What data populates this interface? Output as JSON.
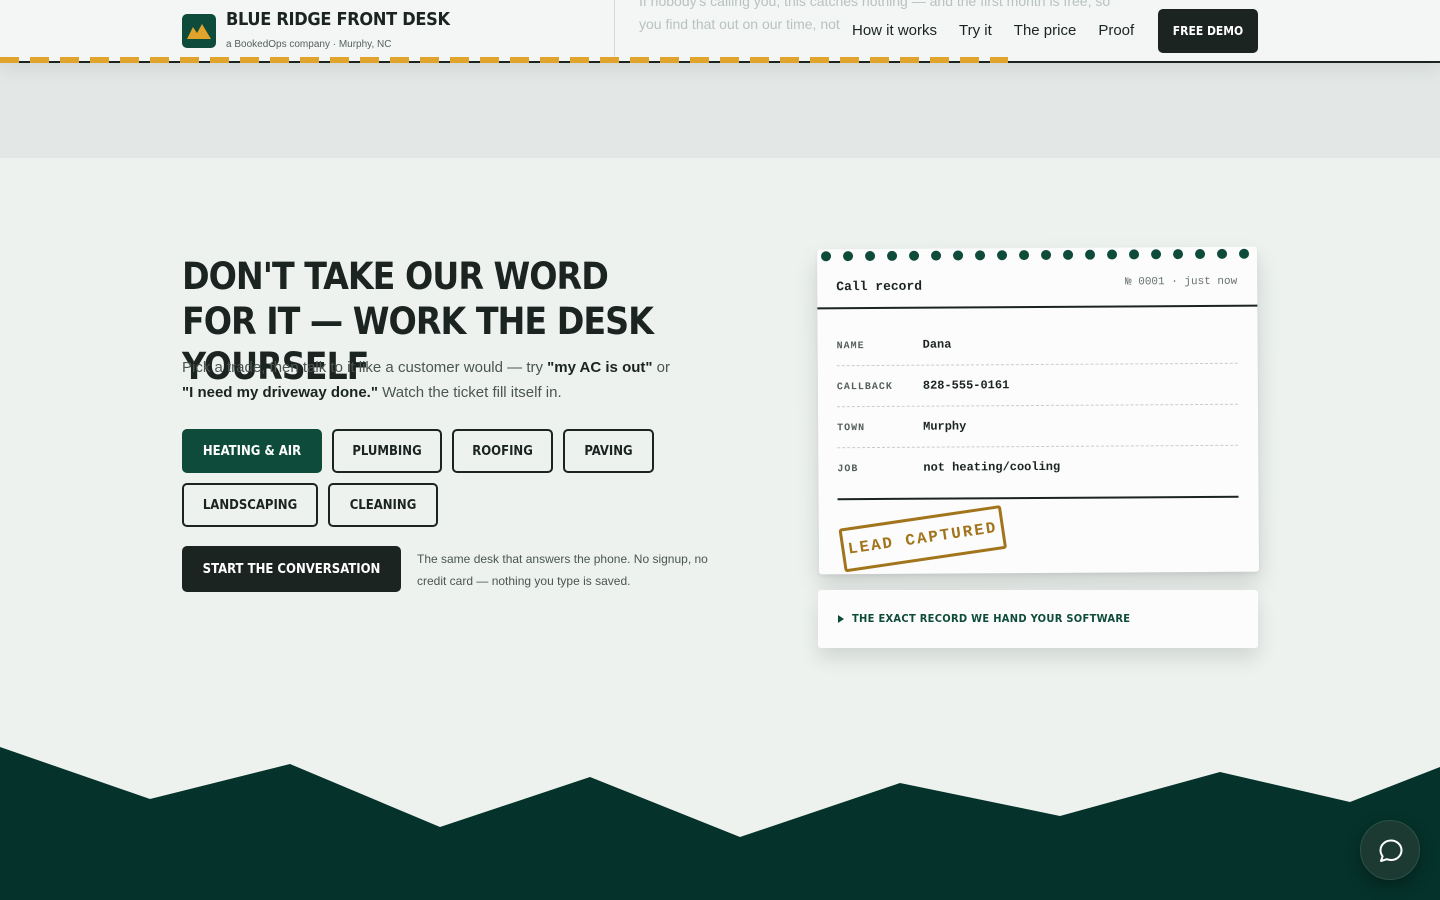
{
  "header": {
    "brand_name": "BLUE RIDGE FRONT DESK",
    "brand_sub": "a BookedOps company · Murphy, NC",
    "background_text": "If nobody's calling you, this catches nothing — and the first month is free, so you find that out on our time, not",
    "nav": [
      "How it works",
      "Try it",
      "The price",
      "Proof"
    ],
    "cta_label": "FREE DEMO"
  },
  "demo": {
    "headline": "DON'T TAKE OUR WORD FOR IT — WORK THE DESK YOURSELF",
    "intro": {
      "part1": "Pick a trade, then talk to it like a customer would — try ",
      "example1": "\"my AC is out\"",
      "part2": " or ",
      "example2": "\"I need my driveway done.\"",
      "part3": " Watch the ticket fill itself in."
    },
    "trades": [
      {
        "label": "HEATING & AIR",
        "active": true
      },
      {
        "label": "PLUMBING",
        "active": false
      },
      {
        "label": "ROOFING",
        "active": false
      },
      {
        "label": "PAVING",
        "active": false
      },
      {
        "label": "LANDSCAPING",
        "active": false
      },
      {
        "label": "CLEANING",
        "active": false
      }
    ],
    "start_label": "START THE CONVERSATION",
    "start_note": "The same desk that answers the phone. No signup, no credit card — nothing you type is saved."
  },
  "record": {
    "title": "Call record",
    "meta": "№ 0001 · just now",
    "fields": [
      {
        "label": "NAME",
        "value": "Dana"
      },
      {
        "label": "CALLBACK",
        "value": "828-555-0161"
      },
      {
        "label": "TOWN",
        "value": "Murphy"
      },
      {
        "label": "JOB",
        "value": "not heating/cooling"
      }
    ],
    "stamp": "LEAD CAPTURED",
    "disclosure_label": "THE EXACT RECORD WE HAND YOUR SOFTWARE"
  },
  "colors": {
    "brand_green": "#0f4b3a",
    "ink": "#1b2421",
    "accent_gold": "#e0a32c",
    "stamp": "#a2741b",
    "page_bg": "#edf2ef",
    "mountain": "#05322a"
  },
  "icons": {
    "logo": "mountain-logo-icon",
    "chat": "chat-bubble-icon",
    "disclosure": "triangle-right-icon"
  }
}
